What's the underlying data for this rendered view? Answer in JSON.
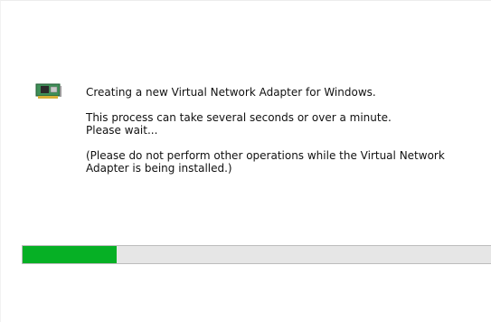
{
  "dialog": {
    "icon": "network-adapter-icon",
    "line1": "Creating a new Virtual Network Adapter for Windows.",
    "line2": "This process can take several seconds or over a minute.",
    "line3": "Please wait...",
    "line4": "(Please do not perform other operations while the Virtual Network Adapter is being installed.)"
  },
  "progress": {
    "percent": 20,
    "fill_color": "#06b025",
    "track_color": "#e6e6e6"
  }
}
